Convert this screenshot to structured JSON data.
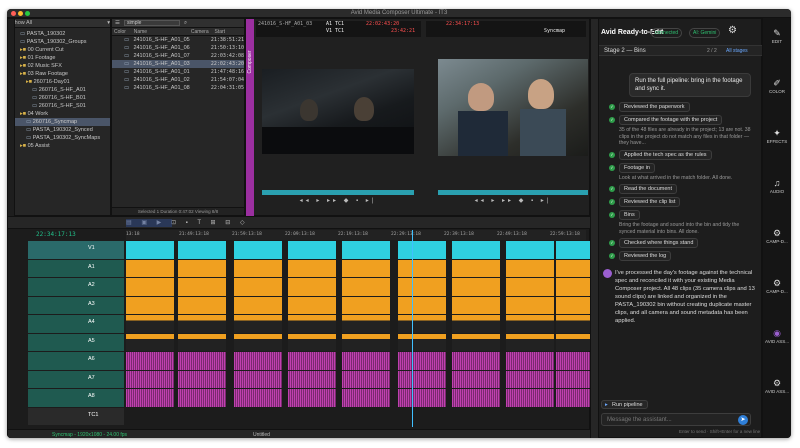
{
  "window": {
    "title": "Avid Media Composer Ultimate - IT3"
  },
  "bins": {
    "dropdown": "Show All",
    "folders": [
      {
        "label": "PASTA_190302",
        "indent": 0,
        "kind": "bin"
      },
      {
        "label": "PASTA_190302_Groups",
        "indent": 0,
        "kind": "bin"
      },
      {
        "label": "00 Current Cut",
        "indent": 0,
        "kind": "folder"
      },
      {
        "label": "01 Footage",
        "indent": 0,
        "kind": "folder"
      },
      {
        "label": "02 Music SFX",
        "indent": 0,
        "kind": "folder"
      },
      {
        "label": "03 Raw Footage",
        "indent": 0,
        "kind": "folder"
      },
      {
        "label": "260716-Day01",
        "indent": 1,
        "kind": "folder"
      },
      {
        "label": "260716_S-HF_A01",
        "indent": 2,
        "kind": "bin"
      },
      {
        "label": "260716_S-HF_B01",
        "indent": 2,
        "kind": "bin"
      },
      {
        "label": "260716_S-HF_S01",
        "indent": 2,
        "kind": "bin"
      },
      {
        "label": "04 Work",
        "indent": 0,
        "kind": "folder"
      },
      {
        "label": "260716_Syncmap",
        "indent": 1,
        "kind": "bin",
        "selected": true
      },
      {
        "label": "PASTA_190302_Synced",
        "indent": 1,
        "kind": "bin"
      },
      {
        "label": "PASTA_190302_SyncMaps",
        "indent": 1,
        "kind": "bin"
      },
      {
        "label": "05 Assist",
        "indent": 0,
        "kind": "folder"
      }
    ]
  },
  "clipbin": {
    "search": "simple",
    "columns": [
      "Color",
      "Name",
      "Camera",
      "Start"
    ],
    "rows": [
      {
        "name": "241016_S-HF_A01_05",
        "start": "21:38:51:21"
      },
      {
        "name": "241016_S-HF_A01_06",
        "start": "21:50:13:10"
      },
      {
        "name": "241016_S-HF_A01_07",
        "start": "22:03:42:08"
      },
      {
        "name": "241016_S-HF_A01_03",
        "start": "22:02:43:20",
        "selected": true
      },
      {
        "name": "241016_S-HF_A01_01",
        "start": "21:47:48:16"
      },
      {
        "name": "241016_S-HF_A01_02",
        "start": "21:54:07:04"
      },
      {
        "name": "241016_S-HF_A01_08",
        "start": "22:04:31:05"
      }
    ],
    "status": "Selected 1  Duration 0:47:02  Viewing 8/8"
  },
  "composer": {
    "tab_label": "Composer",
    "source_labels": {
      "a1": "A1 TC1",
      "v1": "V1 TC1"
    },
    "source_tc": "22:02:43:20",
    "record_tc": "22:34:17:13",
    "source_tc2": "23:42:21",
    "record_name": "Syncmap",
    "source_name": "241016_S-HF_A01_03"
  },
  "timeline": {
    "master_tc": "22:34:17:13",
    "ruler": [
      "13:18",
      "21:49:13:18",
      "21:59:13:18",
      "22:09:13:18",
      "22:19:13:18",
      "22:29:13:18",
      "22:39:13:18",
      "22:49:13:18",
      "22:59:13:18",
      "23:09:13:18"
    ],
    "tracks": [
      "V1",
      "A1",
      "A2",
      "A3",
      "A4",
      "A5",
      "A6",
      "A7",
      "A8",
      "TC1"
    ],
    "bottom_status": "Syncmap - 1920x1080 - 24.00 fps",
    "sequence_name": "Untitled"
  },
  "assistant": {
    "title": "Avid Ready-to-Edit",
    "status_badges": [
      "connected",
      "AI: Gemini"
    ],
    "stage_label": "Stage 2 — Bins",
    "stage_count": "2 / 2",
    "stage_link": "All stages",
    "user_message": "Run the full pipeline: bring in the footage and sync it.",
    "steps": [
      {
        "label": "Reviewed the paperwork"
      },
      {
        "label": "Compared the footage with the project",
        "note": "35 of the 48 files are already in the project; 13 are not. 38 clips in the project do not match any files in that folder — they have..."
      },
      {
        "label": "Applied the tech spec as the rules"
      },
      {
        "label": "Footage in",
        "note": "Look at what arrived in the match folder. All done."
      },
      {
        "label": "Read the document"
      },
      {
        "label": "Reviewed the clip list"
      },
      {
        "label": "Bins",
        "note": "Bring the footage and sound into the bin and tidy the synced material into bins. All done."
      },
      {
        "label": "Checked where things stand"
      },
      {
        "label": "Reviewed the log"
      }
    ],
    "reply": "I've processed the day's footage against the technical spec and reconciled it with your existing Media Composer project. All 48 clips (35 camera clips and 13 sound clips) are linked and organized in the PASTA_190302 bin without creating duplicate master clips, and all camera and sound metadata has been applied.",
    "run_button": "Run pipeline",
    "input_placeholder": "Message the assistant...",
    "hint": "Enter to send · Shift+Enter for a new line"
  },
  "sidebar": {
    "items": [
      {
        "label": "EDIT",
        "icon": "edit-icon"
      },
      {
        "label": "COLOR",
        "icon": "brush-icon"
      },
      {
        "label": "EFFECTS",
        "icon": "effects-icon"
      },
      {
        "label": "AUDIO",
        "icon": "audio-icon"
      },
      {
        "label": "CAMP-D...",
        "icon": "gear-icon"
      },
      {
        "label": "CAMP-D...",
        "icon": "gear-icon"
      },
      {
        "label": "AVID ASS...",
        "icon": "assistant-icon"
      },
      {
        "label": "AVID ASS...",
        "icon": "gear-icon"
      }
    ]
  },
  "colors": {
    "video": "#2fd0e0",
    "audio_orange": "#f0a020",
    "audio_magenta": "#c040b0",
    "accent": "#6aa8ff",
    "green": "#2e9d4a"
  }
}
